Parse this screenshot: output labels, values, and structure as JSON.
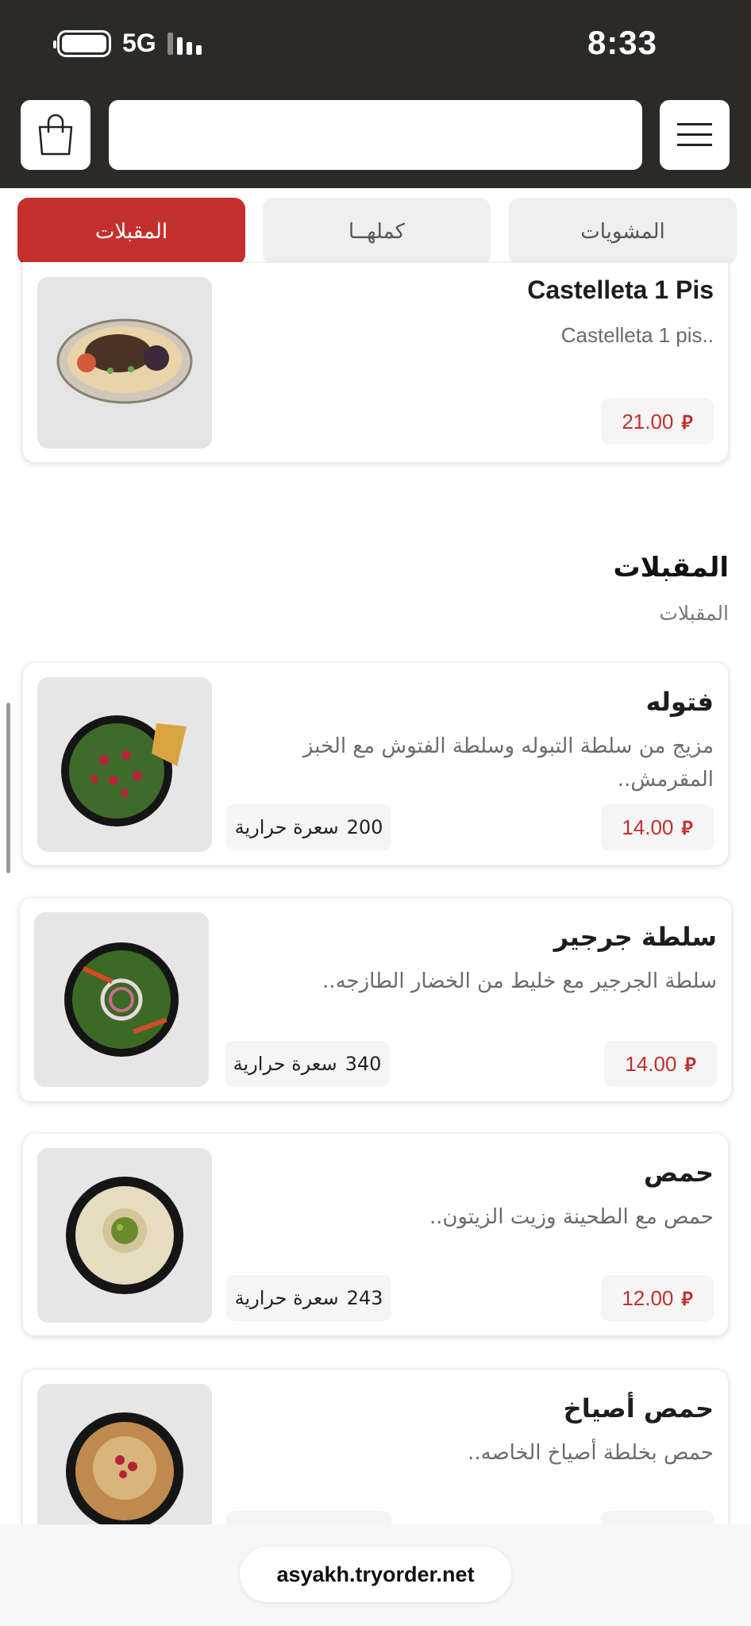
{
  "status_bar": {
    "time": "8:33",
    "network": "5G"
  },
  "header": {
    "search": {
      "value": "",
      "placeholder": ""
    },
    "icons": {
      "cart": "shopping-bag-icon",
      "menu": "hamburger-menu-icon"
    }
  },
  "tabs": [
    {
      "label": "المقبلات",
      "active": true
    },
    {
      "label": "كملهــا",
      "active": false
    },
    {
      "label": "المشويات",
      "active": false
    }
  ],
  "colors": {
    "accent": "#c3302e",
    "header_bg": "#2c2a27",
    "price_text": "#c0302c"
  },
  "currency_symbol": "⃁",
  "previous_item": {
    "title": "Castelleta 1 Pis",
    "description": "Castelleta 1 pis..",
    "price": "21.00"
  },
  "section": {
    "title": "المقبلات",
    "subtitle": "المقبلات"
  },
  "items": [
    {
      "title": "فتوله",
      "description": "مزيج من سلطة التبوله وسلطة الفتوش مع الخبز المقرمش..",
      "price": "14.00",
      "calories_value": "200",
      "calories_unit": "سعرة حرارية"
    },
    {
      "title": "سلطة جرجير",
      "description": "سلطة الجرجير مع خليط من الخضار الطازجه..",
      "price": "14.00",
      "calories_value": "340",
      "calories_unit": "سعرة حرارية"
    },
    {
      "title": "حمص",
      "description": "حمص مع الطحينة وزيت الزيتون..",
      "price": "12.00",
      "calories_value": "243",
      "calories_unit": "سعرة حرارية"
    },
    {
      "title": "حمص أصياخ",
      "description": "حمص بخلطة أصياخ الخاصه.."
    }
  ],
  "url_bar": {
    "domain": "asyakh.tryorder.net"
  }
}
